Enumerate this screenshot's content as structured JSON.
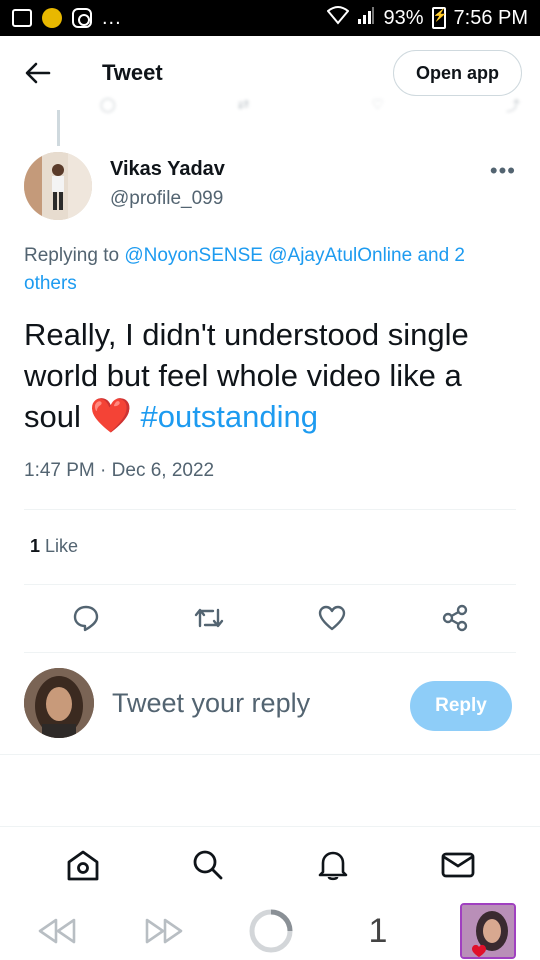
{
  "status_bar": {
    "battery": "93%",
    "time": "7:56 PM",
    "overflow": "..."
  },
  "header": {
    "title": "Tweet",
    "open_app_label": "Open app"
  },
  "tweet": {
    "author_name": "Vikas Yadav",
    "author_handle": "@profile_099",
    "more_label": "•••",
    "replying_prefix": "Replying to",
    "mention_1": "@NoyonSENSE",
    "mention_2": "@AjayAtulOnline",
    "and_others": "and 2 others",
    "text": "Really, I didn't understood single world but feel whole video like a soul",
    "heart_emoji": "❤️",
    "hashtag": "#outstanding",
    "time": "1:47 PM",
    "separator": "·",
    "date": "Dec 6, 2022",
    "like_count": "1",
    "like_label": "Like"
  },
  "reply_box": {
    "placeholder": "Tweet your reply",
    "button_label": "Reply"
  },
  "bottom_nav": [
    "home-icon",
    "search-icon",
    "notifications-icon",
    "messages-icon"
  ],
  "browser_bar": {
    "tab_count": "1"
  },
  "colors": {
    "link": "#1d9bf0",
    "reply_button": "#8ecdf8",
    "heart": "#e0112b"
  }
}
